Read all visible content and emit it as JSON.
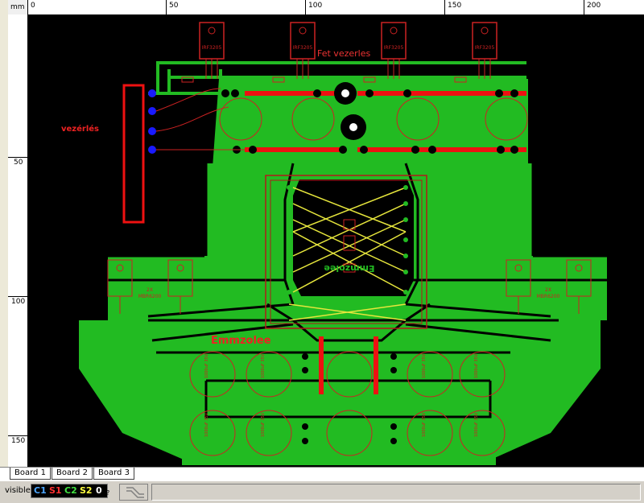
{
  "ruler": {
    "unit": "mm",
    "top_labels": [
      "0",
      "50",
      "100",
      "150",
      "200"
    ],
    "left_labels": [
      "50",
      "100",
      "150"
    ]
  },
  "board": {
    "labels": {
      "control": "vezérlés",
      "fet_control": "Fet vezerles",
      "brand": "Emmzolee",
      "brand_mirror": "Emmzolee",
      "fet_part": "IRF3205",
      "diode_part": "MBR6200",
      "diode_prefix": "2X",
      "cap_part": "1000uF 35V"
    },
    "colors": {
      "background": "#000000",
      "copper": "#22bb22",
      "track_red": "#ee1111",
      "wire_yellow": "#e6e63c",
      "pad_blue": "#1a1aff",
      "outline": "#b21a1a"
    }
  },
  "tabs": [
    {
      "label": "Board 1",
      "active": true
    },
    {
      "label": "Board 2",
      "active": false
    },
    {
      "label": "Board 3",
      "active": false
    }
  ],
  "status": {
    "visible_label": "visible",
    "layers": [
      {
        "label": "C1",
        "color": "#4da6ff"
      },
      {
        "label": "S1",
        "color": "#ff3030"
      },
      {
        "label": "C2",
        "color": "#40e040"
      },
      {
        "label": "S2",
        "color": "#ffff40"
      },
      {
        "label": "0",
        "color": "#ffffff"
      }
    ],
    "help": "?"
  }
}
